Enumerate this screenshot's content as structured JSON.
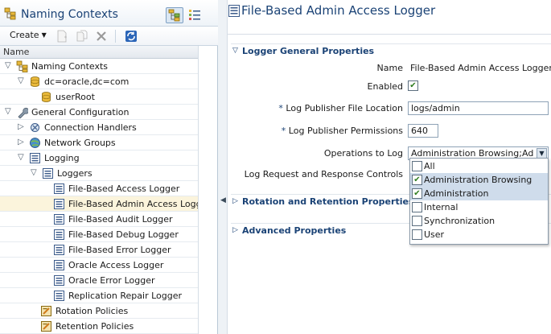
{
  "left_panel": {
    "title": "Naming Contexts",
    "toolbar": {
      "create_label": "Create"
    },
    "column_header": "Name",
    "tree": [
      {
        "label": "Naming Contexts",
        "level": 0,
        "toggle": "expanded",
        "icon": "naming-tree-icon"
      },
      {
        "label": "dc=oracle,dc=com",
        "level": 1,
        "toggle": "expanded",
        "icon": "database-icon"
      },
      {
        "label": "userRoot",
        "level": 2,
        "toggle": "none",
        "icon": "database-icon"
      },
      {
        "label": "General Configuration",
        "level": 0,
        "toggle": "expanded",
        "icon": "wrench-icon"
      },
      {
        "label": "Connection Handlers",
        "level": 1,
        "toggle": "collapsed",
        "icon": "plug-icon"
      },
      {
        "label": "Network Groups",
        "level": 1,
        "toggle": "collapsed",
        "icon": "globe-icon"
      },
      {
        "label": "Logging",
        "level": 1,
        "toggle": "expanded",
        "icon": "list-icon"
      },
      {
        "label": "Loggers",
        "level": 2,
        "toggle": "expanded",
        "icon": "list-icon"
      },
      {
        "label": "File-Based Access Logger",
        "level": 3,
        "toggle": "none",
        "icon": "log-icon"
      },
      {
        "label": "File-Based Admin Access Logger",
        "level": 3,
        "toggle": "none",
        "icon": "log-icon",
        "selected": true
      },
      {
        "label": "File-Based Audit Logger",
        "level": 3,
        "toggle": "none",
        "icon": "log-icon"
      },
      {
        "label": "File-Based Debug Logger",
        "level": 3,
        "toggle": "none",
        "icon": "log-icon"
      },
      {
        "label": "File-Based Error Logger",
        "level": 3,
        "toggle": "none",
        "icon": "log-icon"
      },
      {
        "label": "Oracle Access Logger",
        "level": 3,
        "toggle": "none",
        "icon": "log-icon"
      },
      {
        "label": "Oracle Error Logger",
        "level": 3,
        "toggle": "none",
        "icon": "log-icon"
      },
      {
        "label": "Replication Repair Logger",
        "level": 3,
        "toggle": "none",
        "icon": "log-icon"
      },
      {
        "label": "Rotation Policies",
        "level": 2,
        "toggle": "none",
        "icon": "policy-icon"
      },
      {
        "label": "Retention Policies",
        "level": 2,
        "toggle": "none",
        "icon": "policy-icon"
      }
    ]
  },
  "main": {
    "title": "File-Based Admin Access Logger",
    "sections": {
      "general": "Logger General Properties",
      "rotation": "Rotation and Retention Properties",
      "advanced": "Advanced Properties"
    },
    "fields": {
      "name_label": "Name",
      "name_value": "File-Based Admin Access Logger",
      "enabled_label": "Enabled",
      "enabled_checked": true,
      "file_location_label": "Log Publisher File Location",
      "file_location_value": "logs/admin",
      "permissions_label": "Log Publisher Permissions",
      "permissions_value": "640",
      "operations_label": "Operations to Log",
      "operations_value": "Administration Browsing;Adminis",
      "request_response_label": "Log Request and Response Controls",
      "required_marker": "*"
    },
    "operations_options": [
      {
        "label": "All",
        "checked": false
      },
      {
        "label": "Administration Browsing",
        "checked": true
      },
      {
        "label": "Administration",
        "checked": true
      },
      {
        "label": "Internal",
        "checked": false
      },
      {
        "label": "Synchronization",
        "checked": false
      },
      {
        "label": "User",
        "checked": false
      }
    ]
  },
  "colors": {
    "accent": "#1b4376",
    "selected_row": "#fbf4dc",
    "checked_option": "#cfdceb",
    "check_mark": "#2f7d1f"
  }
}
